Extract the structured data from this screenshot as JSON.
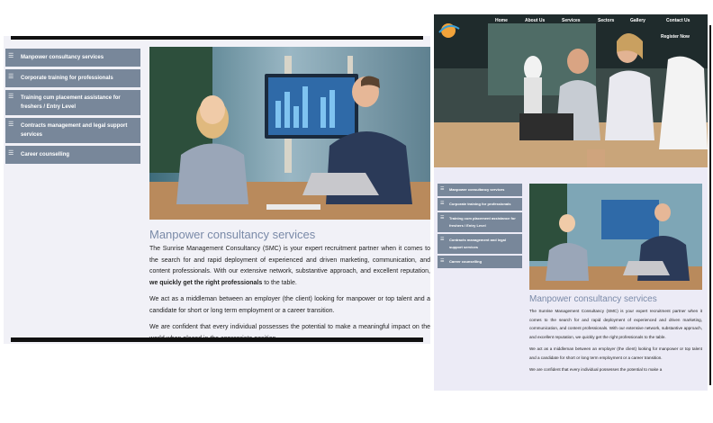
{
  "left": {
    "sidebar": {
      "items": [
        {
          "label": "Manpower consultancy services",
          "icon": "list-icon"
        },
        {
          "label": "Corporate training for professionals",
          "icon": "list-icon"
        },
        {
          "label": "Training cum placement assistance for freshers / Entry Level",
          "icon": "list-icon"
        },
        {
          "label": "Contracts management and legal support services",
          "icon": "list-icon"
        },
        {
          "label": "Career counselling",
          "icon": "list-icon"
        }
      ]
    },
    "title": "Manpower consultancy services",
    "p1_a": "The Sunrise Management Consultancy (SMC) is your expert recruitment partner when it comes to the search for and rapid deployment of experienced and driven marketing, communication, and content professionals. With our extensive network, substantive approach, and excellent reputation, ",
    "p1_b": "we quickly get the right professionals",
    "p1_c": " to the table.",
    "p2": "We act as a middleman between an employer (the client) looking for manpower or top talent and a candidate for short or long term employment or a career transition.",
    "p3": "We are confident that every individual possesses the potential to make a meaningful impact on the world when placed in the appropriate position."
  },
  "right": {
    "nav": {
      "home": "Home",
      "about": "About Us",
      "services": "Services",
      "sectors": "Sectors",
      "gallery": "Gallery",
      "contact": "Contact Us",
      "register": "Register Now"
    },
    "logo_text": "Sunrise Management Consultancy",
    "sidebar": {
      "items": [
        {
          "label": "Manpower consultancy services",
          "icon": "list-icon"
        },
        {
          "label": "Corporate training for professionals",
          "icon": "list-icon"
        },
        {
          "label": "Training cum placement assistance for freshers / Entry Level",
          "icon": "list-icon"
        },
        {
          "label": "Contracts management and legal support services",
          "icon": "list-icon"
        },
        {
          "label": "Career counselling",
          "icon": "list-icon"
        }
      ]
    },
    "title": "Manpower consultancy services",
    "p1": "The Sunrise Management Consultancy (SMC) is your expert recruitment partner when it comes to the search for and rapid deployment of experienced and driven marketing, communication, and content professionals. With our extensive network, substantive approach, and excellent reputation, we quickly get the right professionals to the table.",
    "p2": "We act as a middleman between an employer (the client) looking for manpower or top talent and a candidate for short or long term employment or a career transition.",
    "p3": "We are confident that every individual possesses the potential to make a"
  },
  "colors": {
    "sidebar_bg": "#78879a",
    "title": "#7a8aa8",
    "page_bg": "#f1f1f7"
  }
}
